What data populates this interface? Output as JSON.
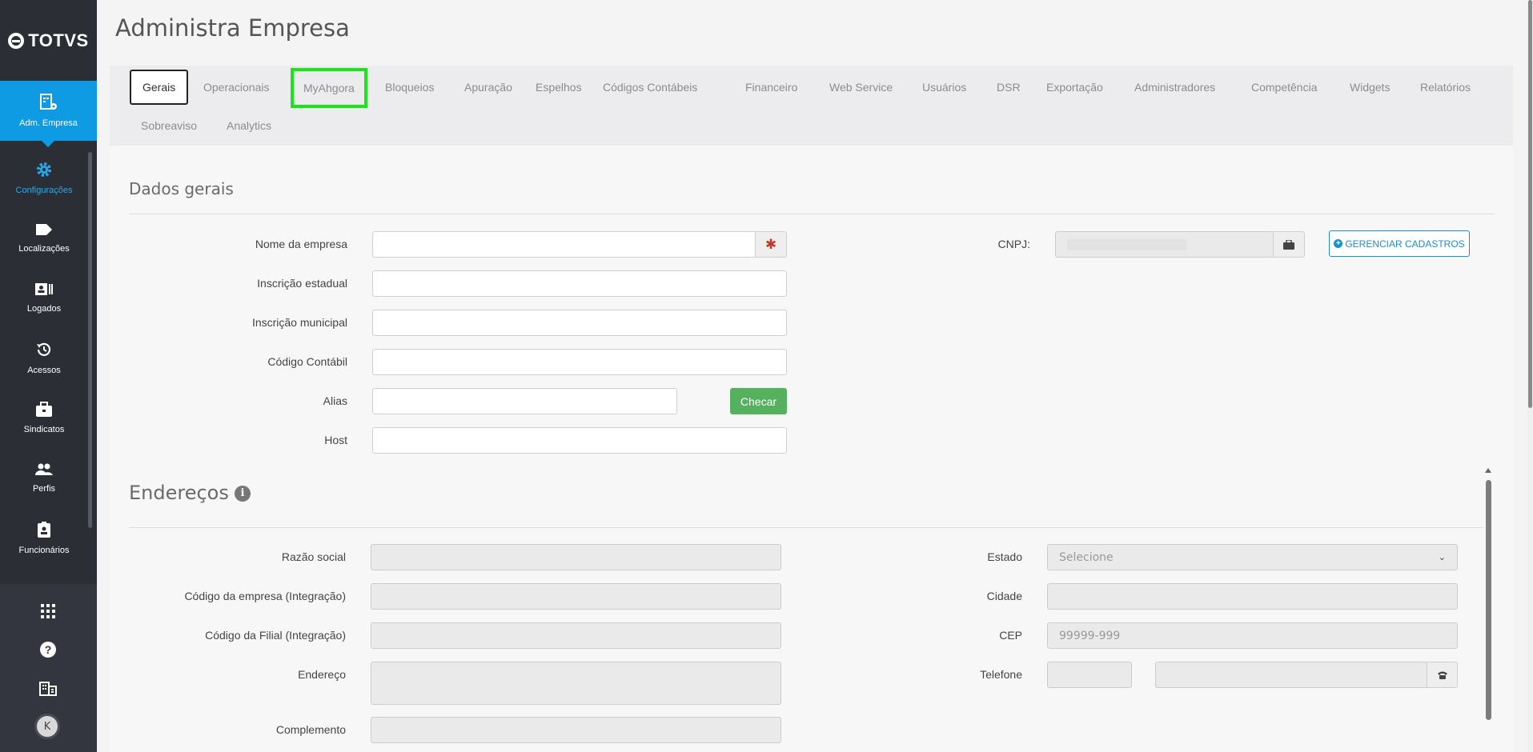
{
  "app": {
    "logo_text": "TOTVS",
    "page_title": "Administra Empresa"
  },
  "sidebar": {
    "items": [
      {
        "label": "Adm. Empresa",
        "icon": "company-admin-icon"
      },
      {
        "label": "Configurações",
        "icon": "gear-icon"
      },
      {
        "label": "Localizações",
        "icon": "tag-icon"
      },
      {
        "label": "Logados",
        "icon": "id-card-icon"
      },
      {
        "label": "Acessos",
        "icon": "history-icon"
      },
      {
        "label": "Sindicatos",
        "icon": "briefcase-icon"
      },
      {
        "label": "Perfis",
        "icon": "users-icon"
      },
      {
        "label": "Funcionários",
        "icon": "badge-icon"
      }
    ],
    "bottom_icons": [
      "apps-grid-icon",
      "help-icon",
      "building-icon"
    ],
    "avatar_initial": "K"
  },
  "tabs": [
    "Gerais",
    "Operacionais",
    "MyAhgora",
    "Bloqueios",
    "Apuração",
    "Espelhos",
    "Códigos Contábeis",
    "Financeiro",
    "Web Service",
    "Usuários",
    "DSR",
    "Exportação",
    "Administradores",
    "Competência",
    "Widgets",
    "Relatórios",
    "Sobreaviso",
    "Analytics"
  ],
  "dados_gerais": {
    "title": "Dados gerais",
    "nome_empresa_label": "Nome da empresa",
    "inscricao_estadual_label": "Inscrição estadual",
    "inscricao_municipal_label": "Inscrição municipal",
    "codigo_contabil_label": "Código Contábil",
    "alias_label": "Alias",
    "checar_button": "Checar",
    "host_label": "Host",
    "cnpj_label": "CNPJ:",
    "gerenciar_button": "GERENCIAR CADASTROS"
  },
  "enderecos": {
    "title": "Endereços",
    "razao_social_label": "Razão social",
    "codigo_empresa_label": "Código da empresa (Integração)",
    "codigo_filial_label": "Código da Filial (Integração)",
    "endereco_label": "Endereço",
    "complemento_label": "Complemento",
    "estado_label": "Estado",
    "estado_value": "Selecione",
    "cidade_label": "Cidade",
    "cep_label": "CEP",
    "cep_placeholder": "99999-999",
    "telefone_label": "Telefone"
  },
  "colors": {
    "brand": "#0f9be3",
    "sidebar": "#2b2e35",
    "success": "#55b15e",
    "highlight": "#19e619"
  }
}
